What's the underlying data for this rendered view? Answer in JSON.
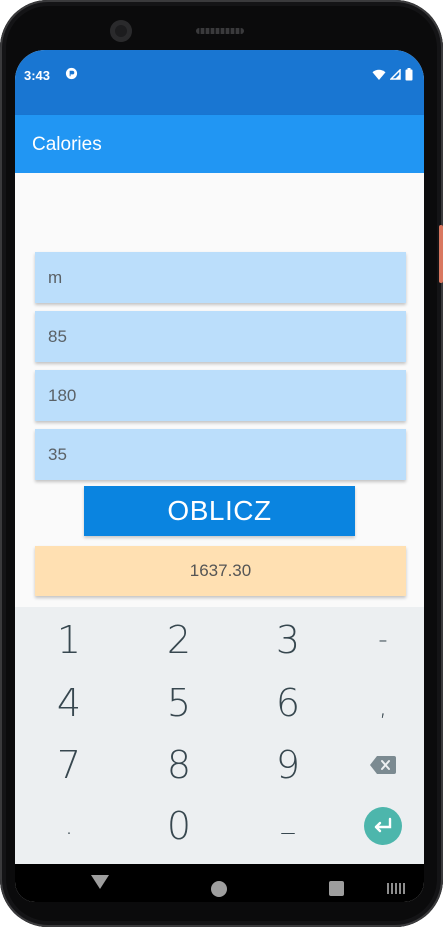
{
  "status_bar": {
    "time": "3:43"
  },
  "app_bar": {
    "title": "Calories"
  },
  "form": {
    "gender": "m",
    "weight": "85",
    "height": "180",
    "age": "35"
  },
  "calculate_button": "OBLICZ",
  "result": "1637.30",
  "keyboard": {
    "rows": [
      [
        "1",
        "2",
        "3",
        "-"
      ],
      [
        "4",
        "5",
        "6",
        ","
      ],
      [
        "7",
        "8",
        "9",
        "backspace"
      ],
      [
        ".",
        "0",
        "_",
        "enter"
      ]
    ],
    "enter_color": "#4db6ac"
  },
  "colors": {
    "status_bar": "#1976d2",
    "app_bar": "#2196f3",
    "input_bg": "#bbdefb",
    "button_bg": "#0a84e0",
    "result_bg": "#ffe0b2"
  }
}
